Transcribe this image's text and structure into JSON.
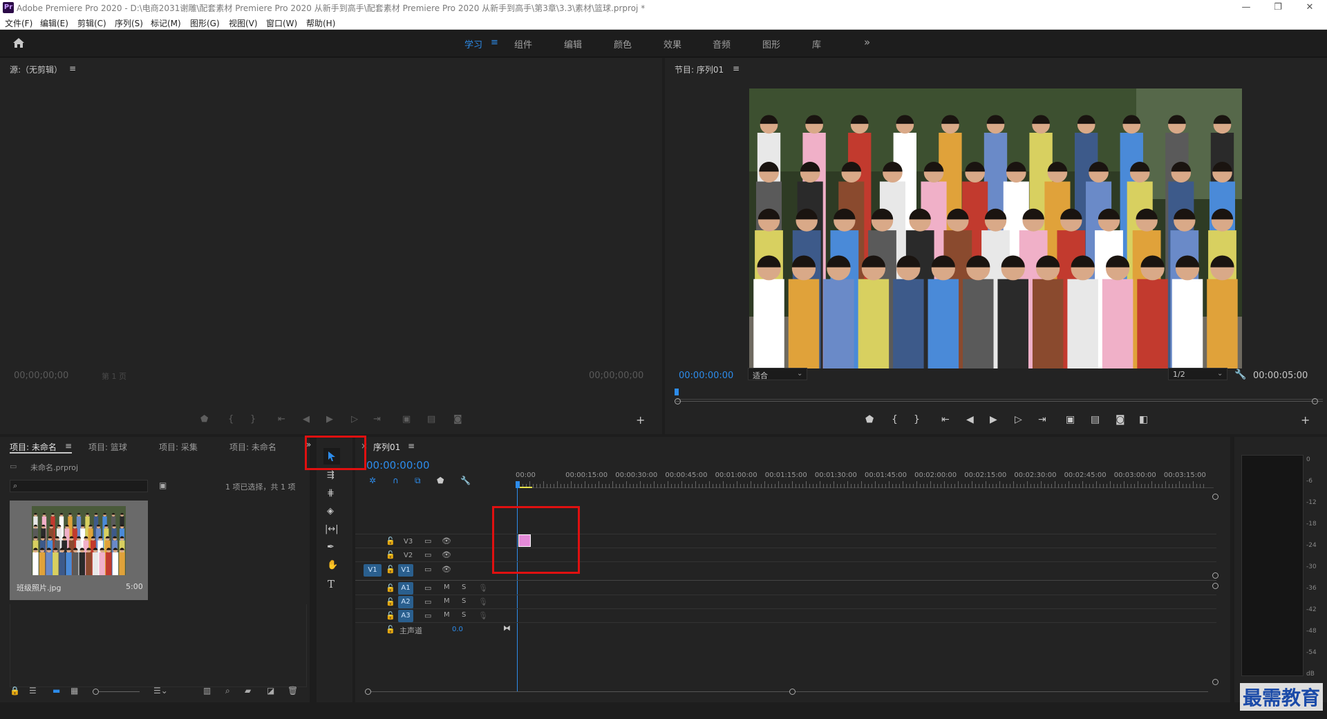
{
  "window": {
    "title": "Adobe Premiere Pro 2020 - D:\\电商2031谢雕\\配套素材 Premiere Pro 2020 从新手到高手\\配套素材 Premiere Pro 2020 从新手到高手\\第3章\\3.3\\素材\\篮球.prproj *",
    "app_icon": "Pr",
    "minimize": "—",
    "maximize": "❐",
    "close": "✕"
  },
  "menu": [
    "文件(F)",
    "编辑(E)",
    "剪辑(C)",
    "序列(S)",
    "标记(M)",
    "图形(G)",
    "视图(V)",
    "窗口(W)",
    "帮助(H)"
  ],
  "workspaces": {
    "tabs": [
      "学习",
      "组件",
      "编辑",
      "颜色",
      "效果",
      "音频",
      "图形",
      "库"
    ],
    "menu_icon": "≡",
    "more": "»"
  },
  "source": {
    "title": "源:（无剪辑）",
    "menu": "≡",
    "tc_left": "00;00;00;00",
    "page": "第 1 页",
    "tc_right": "00;00;00;00",
    "add": "+"
  },
  "program": {
    "title": "节目: 序列01",
    "menu": "≡",
    "tc_left": "00:00:00:00",
    "fit": "适合",
    "res": "1/2",
    "tc_right": "00:00:05:00",
    "add": "+"
  },
  "project": {
    "tabs": [
      "项目: 未命名",
      "项目: 篮球",
      "项目: 采集",
      "项目: 未命名"
    ],
    "menu": "≡",
    "more": "»",
    "file": "未命名.prproj",
    "search_placeholder": "",
    "selection": "1 项已选择，共 1 项",
    "clip_name": "班级照片.jpg",
    "clip_dur": "5:00"
  },
  "timeline": {
    "title": "序列01",
    "menu": "≡",
    "close": "×",
    "tc": "00:00:00:00",
    "ruler": [
      "00:00",
      "00:00:15:00",
      "00:00:30:00",
      "00:00:45:00",
      "00:01:00:00",
      "00:01:15:00",
      "00:01:30:00",
      "00:01:45:00",
      "00:02:00:00",
      "00:02:15:00",
      "00:02:30:00",
      "00:02:45:00",
      "00:03:00:00",
      "00:03:15:00"
    ],
    "video_tracks": [
      "V3",
      "V2",
      "V1"
    ],
    "audio_tracks": [
      "A1",
      "A2",
      "A3"
    ],
    "source_v1": "V1",
    "master": "主声道",
    "master_val": "0.0",
    "mute": "M",
    "solo": "S"
  },
  "meter": {
    "labels": [
      "0",
      "-6",
      "-12",
      "-18",
      "-24",
      "-30",
      "-36",
      "-42",
      "-48",
      "-54",
      "dB"
    ]
  },
  "watermark": "最需教育",
  "colors": {
    "accent": "#2d8ceb",
    "highlight_box": "#e01010",
    "clip_pink": "#e48ad8",
    "track_blue": "#2a5f8e"
  }
}
